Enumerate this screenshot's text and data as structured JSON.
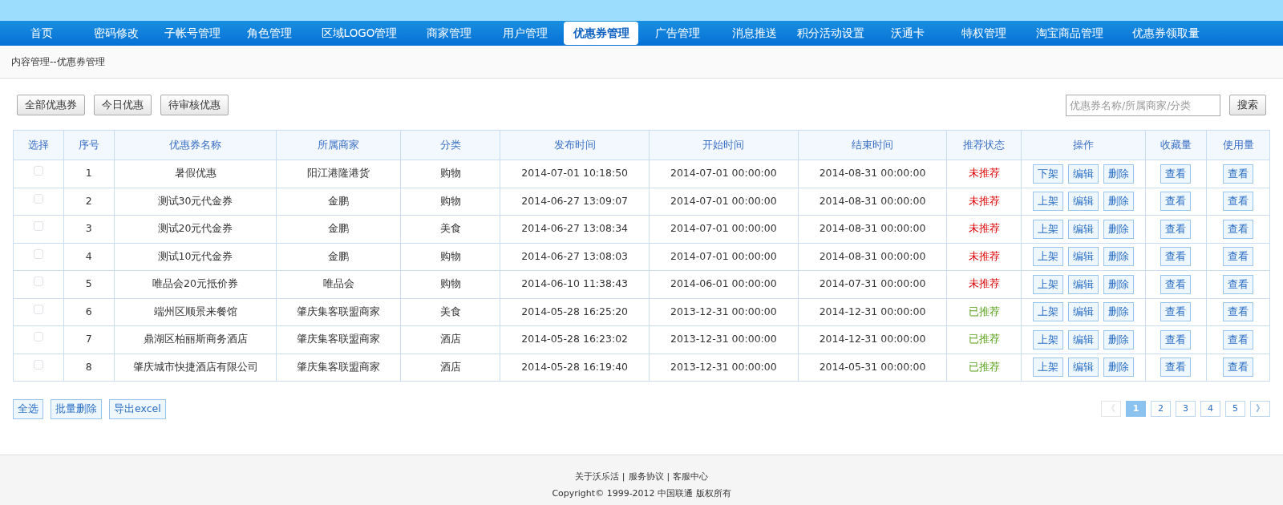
{
  "nav": [
    {
      "label": "首页",
      "selected": false
    },
    {
      "label": "密码修改",
      "selected": false
    },
    {
      "label": "子帐号管理",
      "selected": false
    },
    {
      "label": "角色管理",
      "selected": false
    },
    {
      "label": "区域LOGO管理",
      "selected": false
    },
    {
      "label": "商家管理",
      "selected": false
    },
    {
      "label": "用户管理",
      "selected": false
    },
    {
      "label": "优惠券管理",
      "selected": true
    },
    {
      "label": "广告管理",
      "selected": false
    },
    {
      "label": "消息推送",
      "selected": false
    },
    {
      "label": "积分活动设置",
      "selected": false
    },
    {
      "label": "沃通卡",
      "selected": false
    },
    {
      "label": "特权管理",
      "selected": false
    },
    {
      "label": "淘宝商品管理",
      "selected": false
    },
    {
      "label": "优惠券领取量",
      "selected": false
    }
  ],
  "breadcrumb": "内容管理--优惠券管理",
  "filters": [
    "全部优惠券",
    "今日优惠",
    "待审核优惠"
  ],
  "search": {
    "placeholder": "优惠券名称/所属商家/分类",
    "button": "搜索"
  },
  "table": {
    "columns": [
      "选择",
      "序号",
      "优惠券名称",
      "所属商家",
      "分类",
      "发布时间",
      "开始时间",
      "结束时间",
      "推荐状态",
      "操作",
      "收藏量",
      "使用量"
    ],
    "rows": [
      {
        "checked": false,
        "index": "1",
        "name": "暑假优惠",
        "merchant": "阳江港隆港货",
        "category": "购物",
        "published": "2014-07-01 10:18:50",
        "start": "2014-07-01 00:00:00",
        "end": "2014-08-31 00:00:00",
        "status": "未推荐",
        "recommended": false,
        "actions": [
          "下架",
          "编辑",
          "删除"
        ],
        "favorites": "查看",
        "usage": "查看"
      },
      {
        "checked": false,
        "index": "2",
        "name": "测试30元代金券",
        "merchant": "金鹏",
        "category": "购物",
        "published": "2014-06-27 13:09:07",
        "start": "2014-07-01 00:00:00",
        "end": "2014-08-31 00:00:00",
        "status": "未推荐",
        "recommended": false,
        "actions": [
          "上架",
          "编辑",
          "删除"
        ],
        "favorites": "查看",
        "usage": "查看"
      },
      {
        "checked": false,
        "index": "3",
        "name": "测试20元代金券",
        "merchant": "金鹏",
        "category": "美食",
        "published": "2014-06-27 13:08:34",
        "start": "2014-07-01 00:00:00",
        "end": "2014-08-31 00:00:00",
        "status": "未推荐",
        "recommended": false,
        "actions": [
          "上架",
          "编辑",
          "删除"
        ],
        "favorites": "查看",
        "usage": "查看"
      },
      {
        "checked": false,
        "index": "4",
        "name": "测试10元代金券",
        "merchant": "金鹏",
        "category": "购物",
        "published": "2014-06-27 13:08:03",
        "start": "2014-07-01 00:00:00",
        "end": "2014-08-31 00:00:00",
        "status": "未推荐",
        "recommended": false,
        "actions": [
          "上架",
          "编辑",
          "删除"
        ],
        "favorites": "查看",
        "usage": "查看"
      },
      {
        "checked": false,
        "index": "5",
        "name": "唯品会20元抵价券",
        "merchant": "唯品会",
        "category": "购物",
        "published": "2014-06-10 11:38:43",
        "start": "2014-06-01 00:00:00",
        "end": "2014-07-31 00:00:00",
        "status": "未推荐",
        "recommended": false,
        "actions": [
          "上架",
          "编辑",
          "删除"
        ],
        "favorites": "查看",
        "usage": "查看"
      },
      {
        "checked": false,
        "index": "6",
        "name": "端州区顺景来餐馆",
        "merchant": "肇庆集客联盟商家",
        "category": "美食",
        "published": "2014-05-28 16:25:20",
        "start": "2013-12-31 00:00:00",
        "end": "2014-12-31 00:00:00",
        "status": "已推荐",
        "recommended": true,
        "actions": [
          "上架",
          "编辑",
          "删除"
        ],
        "favorites": "查看",
        "usage": "查看"
      },
      {
        "checked": false,
        "index": "7",
        "name": "鼎湖区柏丽斯商务酒店",
        "merchant": "肇庆集客联盟商家",
        "category": "酒店",
        "published": "2014-05-28 16:23:02",
        "start": "2013-12-31 00:00:00",
        "end": "2014-12-31 00:00:00",
        "status": "已推荐",
        "recommended": true,
        "actions": [
          "上架",
          "编辑",
          "删除"
        ],
        "favorites": "查看",
        "usage": "查看"
      },
      {
        "checked": false,
        "index": "8",
        "name": "肇庆城市快捷酒店有限公司",
        "merchant": "肇庆集客联盟商家",
        "category": "酒店",
        "published": "2014-05-28 16:19:40",
        "start": "2013-12-31 00:00:00",
        "end": "2014-05-31 00:00:00",
        "status": "已推荐",
        "recommended": true,
        "actions": [
          "上架",
          "编辑",
          "删除"
        ],
        "favorites": "查看",
        "usage": "查看"
      }
    ]
  },
  "bulk_actions": [
    "全选",
    "批量删除",
    "导出excel"
  ],
  "pagination": {
    "prev": {
      "label": "《",
      "disabled": true
    },
    "pages": [
      {
        "label": "1",
        "selected": true
      },
      {
        "label": "2",
        "selected": false
      },
      {
        "label": "3",
        "selected": false
      },
      {
        "label": "4",
        "selected": false
      },
      {
        "label": "5",
        "selected": false
      }
    ],
    "next": {
      "label": "》",
      "disabled": false
    }
  },
  "footer": {
    "links": [
      "关于沃乐活",
      "服务协议",
      "客服中心"
    ],
    "separator": "|",
    "copyright": "Copyright© 1999-2012 中国联通 版权所有"
  }
}
